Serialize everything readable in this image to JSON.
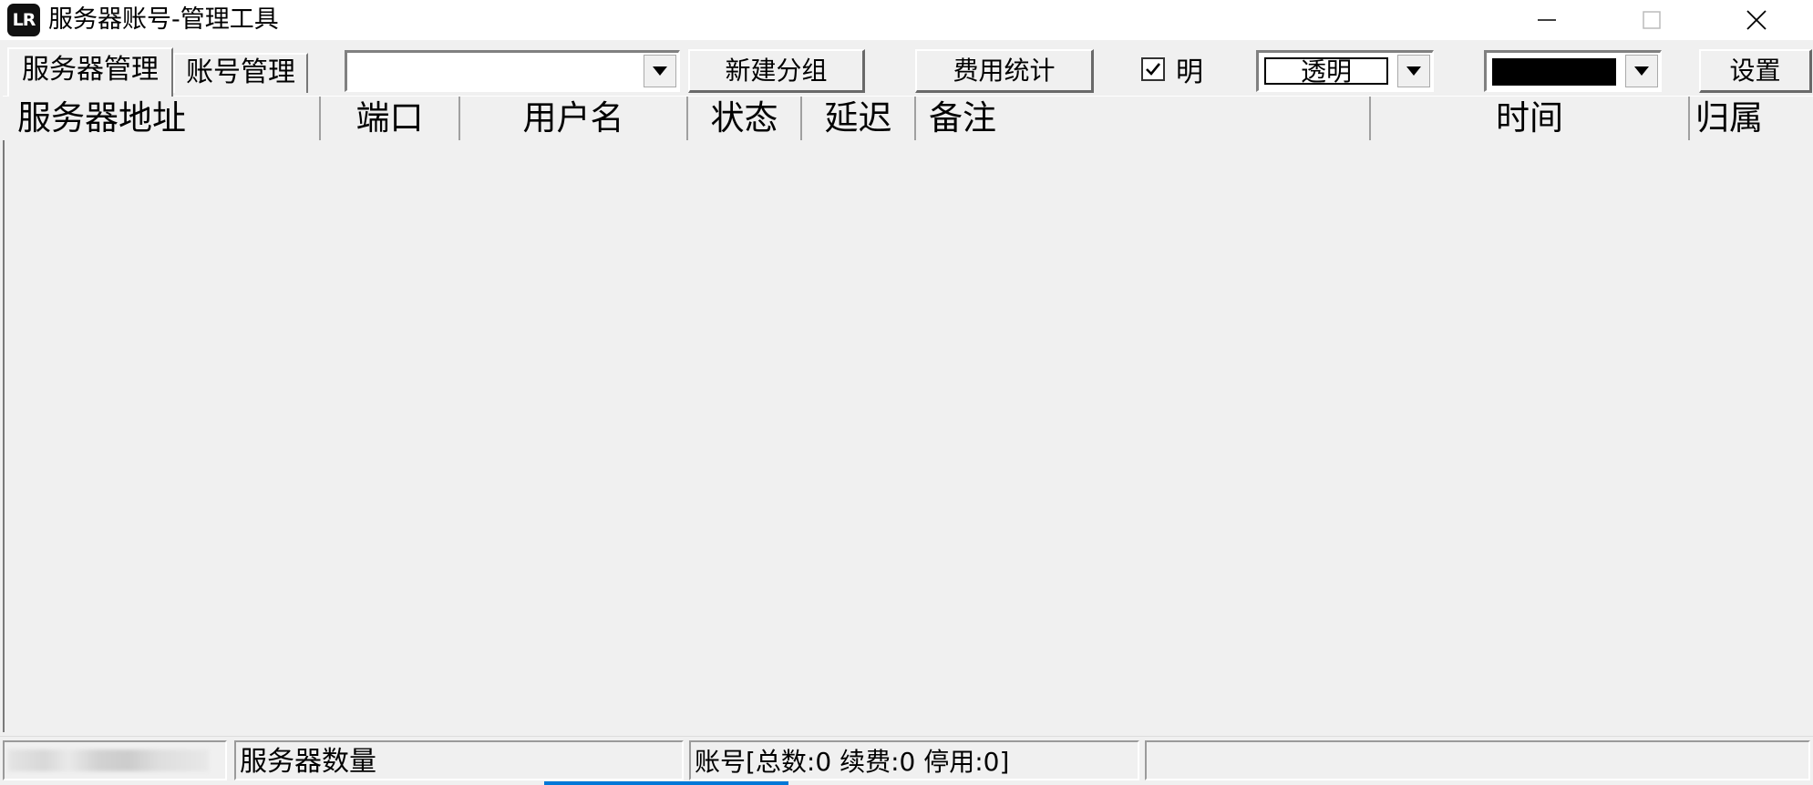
{
  "window": {
    "logo_text": "LR",
    "title": "服务器账号-管理工具"
  },
  "toolbar": {
    "tab_servers": "服务器管理",
    "tab_accounts": "账号管理",
    "group_select_value": "",
    "new_group_label": "新建分组",
    "cost_stats_label": "费用统计",
    "bright_checkbox_checked": true,
    "bright_label": "明",
    "transparency_value": "透明",
    "color_value": "#000000",
    "settings_label": "设置"
  },
  "table": {
    "columns": [
      "服务器地址",
      "端口",
      "用户名",
      "状态",
      "延迟",
      "备注",
      "时间",
      "归属"
    ],
    "rows": []
  },
  "status": {
    "server_count_label": "服务器数量",
    "account_summary": "账号[总数:0 续费:0 停用:0]",
    "extra": ""
  },
  "colors": {
    "accent": "#0078d7",
    "window_bg": "#f0f0f0"
  }
}
